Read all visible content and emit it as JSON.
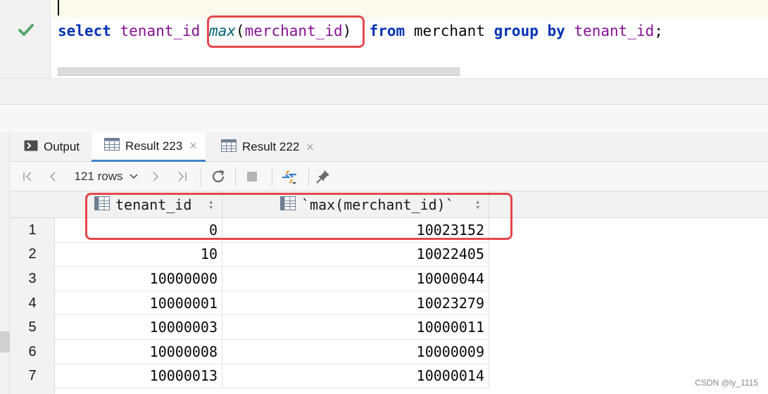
{
  "editor": {
    "code": {
      "select": "select",
      "col1": "tenant_id",
      "fn": "max",
      "arg_open": "(",
      "arg": "merchant_id",
      "arg_close": ")",
      "from": "from",
      "table": "merchant",
      "group": "group",
      "by": "by",
      "col2": "tenant_id",
      "semi": ";"
    },
    "status_icon": "check-icon",
    "highlight_color": "#e5484d"
  },
  "tabs": [
    {
      "label": "Output",
      "icon": "console-icon"
    },
    {
      "label": "Result 223",
      "icon": "table-icon",
      "close": "×",
      "active": true
    },
    {
      "label": "Result 222",
      "icon": "table-icon",
      "close": "×"
    }
  ],
  "toolbar": {
    "rows_label": "121 rows",
    "icons": [
      "first-page-icon",
      "prev-page-icon",
      "next-page-icon",
      "last-page-icon",
      "refresh-icon",
      "stop-icon",
      "compare-icon",
      "pin-icon"
    ]
  },
  "grid": {
    "columns": [
      {
        "label": "tenant_id"
      },
      {
        "label": "`max(merchant_id)`"
      }
    ],
    "rows": [
      {
        "n": "1",
        "tenant_id": "0",
        "max": "10023152"
      },
      {
        "n": "2",
        "tenant_id": "10",
        "max": "10022405"
      },
      {
        "n": "3",
        "tenant_id": "10000000",
        "max": "10000044"
      },
      {
        "n": "4",
        "tenant_id": "10000001",
        "max": "10023279"
      },
      {
        "n": "5",
        "tenant_id": "10000003",
        "max": "10000011"
      },
      {
        "n": "6",
        "tenant_id": "10000008",
        "max": "10000009"
      },
      {
        "n": "7",
        "tenant_id": "10000013",
        "max": "10000014"
      }
    ]
  },
  "watermark": "CSDN @ly_1115",
  "colors": {
    "accent": "#4083c9",
    "keyword": "#0033b3",
    "identifier": "#871094",
    "check": "#59a869"
  }
}
